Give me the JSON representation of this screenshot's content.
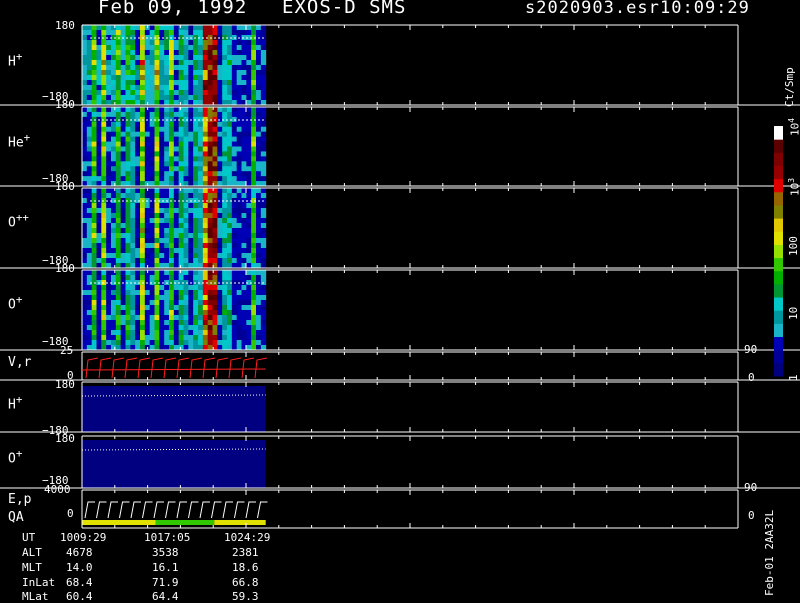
{
  "header": {
    "date": "Feb 09, 1992",
    "mission": "EXOS-D SMS",
    "file": "s2020903.esr",
    "time": "10:09:29"
  },
  "panels": {
    "p1": {
      "label": "H",
      "sup": "+",
      "top": "180",
      "bottom": "−180"
    },
    "p2": {
      "label": "He",
      "sup": "+",
      "top": "180",
      "bottom": "−180"
    },
    "p3": {
      "label": "O",
      "sup": "++",
      "top": "180",
      "bottom": "−180"
    },
    "p4": {
      "label": "O",
      "sup": "+",
      "top": "180",
      "bottom": "−180"
    },
    "p5": {
      "label": "V,r",
      "ytop": "25",
      "ybot": "0",
      "rtop": "90",
      "rbot": "0"
    },
    "p6": {
      "label": "H",
      "sup": "+",
      "top": "180",
      "bottom": "−180"
    },
    "p7": {
      "label": "O",
      "sup": "+",
      "top": "180",
      "bottom": "−180"
    },
    "p8": {
      "label": "E,p",
      "ytop": "4000",
      "ybot": "0",
      "rtop": "90",
      "rbot": "0"
    },
    "p9": {
      "label": "QA"
    }
  },
  "colorbar": {
    "unit": "Ct/Smp",
    "ticks": [
      {
        "text": "1",
        "pos": 0.02
      },
      {
        "text": "10",
        "pos": 0.265
      },
      {
        "text": "100",
        "pos": 0.52
      },
      {
        "text": "10",
        "sup": "3",
        "pos": 0.76
      },
      {
        "text": "10",
        "sup": "4",
        "pos": 1.0
      }
    ],
    "colors": [
      "#00007f",
      "#000096",
      "#0000b4",
      "#19b4c8",
      "#0096a0",
      "#00c8c8",
      "#009632",
      "#00af00",
      "#32c800",
      "#96e100",
      "#e1e100",
      "#e1c800",
      "#7f7f00",
      "#966400",
      "#e10000",
      "#960000",
      "#7f0000",
      "#5a0000",
      "#ffffff"
    ]
  },
  "footer": {
    "rows": [
      {
        "name": "UT",
        "v": [
          "1009:29",
          "1017:05",
          "1024:29"
        ]
      },
      {
        "name": "ALT",
        "v": [
          "4678",
          "3538",
          "2381"
        ]
      },
      {
        "name": "MLT",
        "v": [
          "14.0",
          "16.1",
          "18.6"
        ]
      },
      {
        "name": "InLat",
        "v": [
          "68.4",
          "71.9",
          "66.8"
        ]
      },
      {
        "name": "MLat",
        "v": [
          "60.4",
          "64.4",
          "59.3"
        ]
      }
    ],
    "side_label": "Feb-01 2AA32L"
  },
  "chart_data": {
    "type": "heatmap",
    "title": "Feb 09, 1992   EXOS-D SMS",
    "x_time_ticks": [
      "1009:29",
      "1017:05",
      "1024:29"
    ],
    "spectrogram_panels": [
      "H+",
      "He+",
      "O++",
      "O+"
    ],
    "pitch_angle_range": [
      -180,
      180
    ],
    "data_extent_fraction_of_time_axis": 0.28,
    "counts_scale": "log",
    "counts_range": [
      1,
      10000
    ],
    "vr_range": [
      0,
      25
    ],
    "ep_range": [
      0,
      4000
    ],
    "right_axis_range": [
      0,
      90
    ]
  }
}
